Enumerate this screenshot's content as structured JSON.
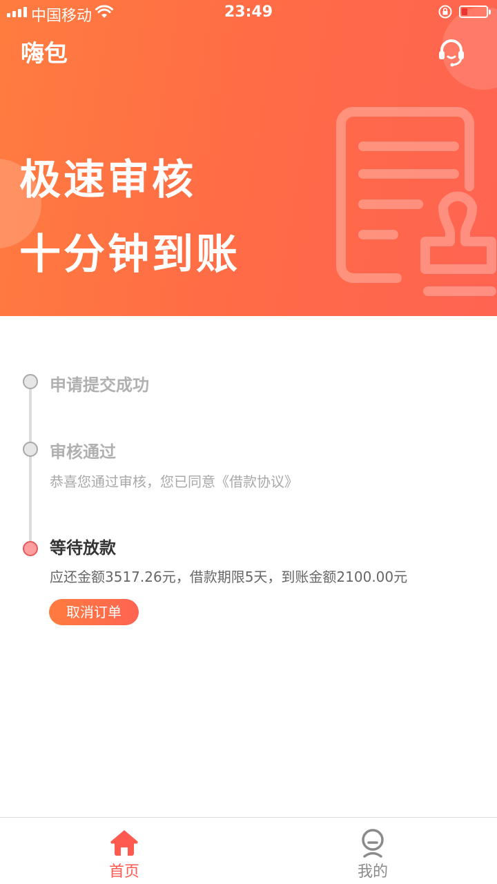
{
  "status_bar": {
    "carrier": "中国移动",
    "time": "23:49"
  },
  "header": {
    "app_title": "嗨包"
  },
  "banner": {
    "line1": "极速审核",
    "line2": "十分钟到账"
  },
  "timeline": {
    "steps": [
      {
        "title": "申请提交成功",
        "desc": ""
      },
      {
        "title": "审核通过",
        "desc": "恭喜您通过审核，您已同意《借款协议》"
      },
      {
        "title": "等待放款",
        "desc": "应还金额3517.26元，借款期限5天，到账金额2100.00元"
      }
    ],
    "cancel_label": "取消订单"
  },
  "tabbar": {
    "home_label": "首页",
    "mine_label": "我的"
  },
  "colors": {
    "accent": "#ff5a4f",
    "hero_start": "#ff7c3f",
    "hero_end": "#ff6452"
  },
  "icons": [
    "signal-icon",
    "wifi-icon",
    "rotation-lock-icon",
    "battery-icon",
    "customer-service-icon",
    "home-icon",
    "profile-icon"
  ]
}
